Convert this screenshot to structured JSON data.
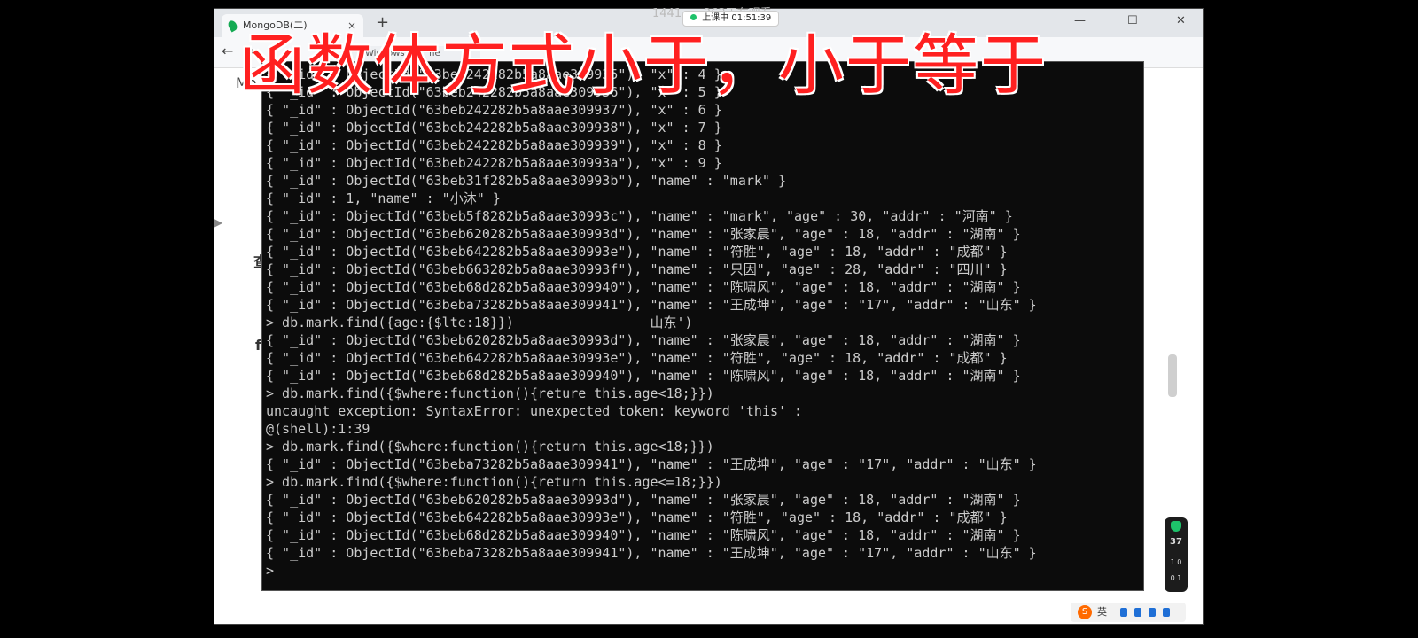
{
  "browser": {
    "tab_title": "MongoDB(二)",
    "tab_close": "×",
    "new_tab": "+",
    "win_min": "—",
    "win_max": "☐",
    "win_close": "✕",
    "back": "←",
    "forward": "→",
    "bookmark": "Windows Po... ne"
  },
  "stream": {
    "viewers_text": "1441......263正在观看",
    "live_label": "上课中 01:51:39"
  },
  "overlay": {
    "title": "函数体方式小于，小于等于"
  },
  "page_peek": {
    "left_1": "Mo",
    "left_2": "查",
    "left_3": "f"
  },
  "terminal": {
    "lines": [
      "{ \"_id\" : ObjectId(\"63beb242282b5a8aae309935\"), \"x\" : 4 }",
      "{ \"_id\" : ObjectId(\"63beb242282b5a8aae309936\"), \"x\" : 5 }",
      "{ \"_id\" : ObjectId(\"63beb242282b5a8aae309937\"), \"x\" : 6 }",
      "{ \"_id\" : ObjectId(\"63beb242282b5a8aae309938\"), \"x\" : 7 }",
      "{ \"_id\" : ObjectId(\"63beb242282b5a8aae309939\"), \"x\" : 8 }",
      "{ \"_id\" : ObjectId(\"63beb242282b5a8aae30993a\"), \"x\" : 9 }",
      "{ \"_id\" : ObjectId(\"63beb31f282b5a8aae30993b\"), \"name\" : \"mark\" }",
      "{ \"_id\" : 1, \"name\" : \"小沐\" }",
      "{ \"_id\" : ObjectId(\"63beb5f8282b5a8aae30993c\"), \"name\" : \"mark\", \"age\" : 30, \"addr\" : \"河南\" }",
      "{ \"_id\" : ObjectId(\"63beb620282b5a8aae30993d\"), \"name\" : \"张家晨\", \"age\" : 18, \"addr\" : \"湖南\" }",
      "{ \"_id\" : ObjectId(\"63beb642282b5a8aae30993e\"), \"name\" : \"符胜\", \"age\" : 18, \"addr\" : \"成都\" }",
      "{ \"_id\" : ObjectId(\"63beb663282b5a8aae30993f\"), \"name\" : \"只因\", \"age\" : 28, \"addr\" : \"四川\" }",
      "{ \"_id\" : ObjectId(\"63beb68d282b5a8aae309940\"), \"name\" : \"陈啸风\", \"age\" : 18, \"addr\" : \"湖南\" }",
      "{ \"_id\" : ObjectId(\"63beba73282b5a8aae309941\"), \"name\" : \"王成坤\", \"age\" : \"17\", \"addr\" : \"山东\" }",
      "> db.mark.find({age:{$lte:18}})                 山东')",
      "{ \"_id\" : ObjectId(\"63beb620282b5a8aae30993d\"), \"name\" : \"张家晨\", \"age\" : 18, \"addr\" : \"湖南\" }",
      "{ \"_id\" : ObjectId(\"63beb642282b5a8aae30993e\"), \"name\" : \"符胜\", \"age\" : 18, \"addr\" : \"成都\" }",
      "{ \"_id\" : ObjectId(\"63beb68d282b5a8aae309940\"), \"name\" : \"陈啸风\", \"age\" : 18, \"addr\" : \"湖南\" }",
      "> db.mark.find({$where:function(){reture this.age<18;}})",
      "uncaught exception: SyntaxError: unexpected token: keyword 'this' :",
      "@(shell):1:39",
      "> db.mark.find({$where:function(){return this.age<18;}})",
      "{ \"_id\" : ObjectId(\"63beba73282b5a8aae309941\"), \"name\" : \"王成坤\", \"age\" : \"17\", \"addr\" : \"山东\" }",
      "> db.mark.find({$where:function(){return this.age<=18;}})",
      "{ \"_id\" : ObjectId(\"63beb620282b5a8aae30993d\"), \"name\" : \"张家晨\", \"age\" : 18, \"addr\" : \"湖南\" }",
      "{ \"_id\" : ObjectId(\"63beb642282b5a8aae30993e\"), \"name\" : \"符胜\", \"age\" : 18, \"addr\" : \"成都\" }",
      "{ \"_id\" : ObjectId(\"63beb68d282b5a8aae309940\"), \"name\" : \"陈啸风\", \"age\" : 18, \"addr\" : \"湖南\" }",
      "{ \"_id\" : ObjectId(\"63beba73282b5a8aae309941\"), \"name\" : \"王成坤\", \"age\" : \"17\", \"addr\" : \"山东\" }",
      ">"
    ]
  },
  "tray": {
    "ime_logo": "S",
    "ime_lang": "英",
    "widget_percent": "37",
    "widget_v1": "1.0",
    "widget_v2": "0.1"
  },
  "colors": {
    "overlay_red": "#ff2020",
    "terminal_bg": "#0c0c0c",
    "terminal_fg": "#cccccc"
  }
}
